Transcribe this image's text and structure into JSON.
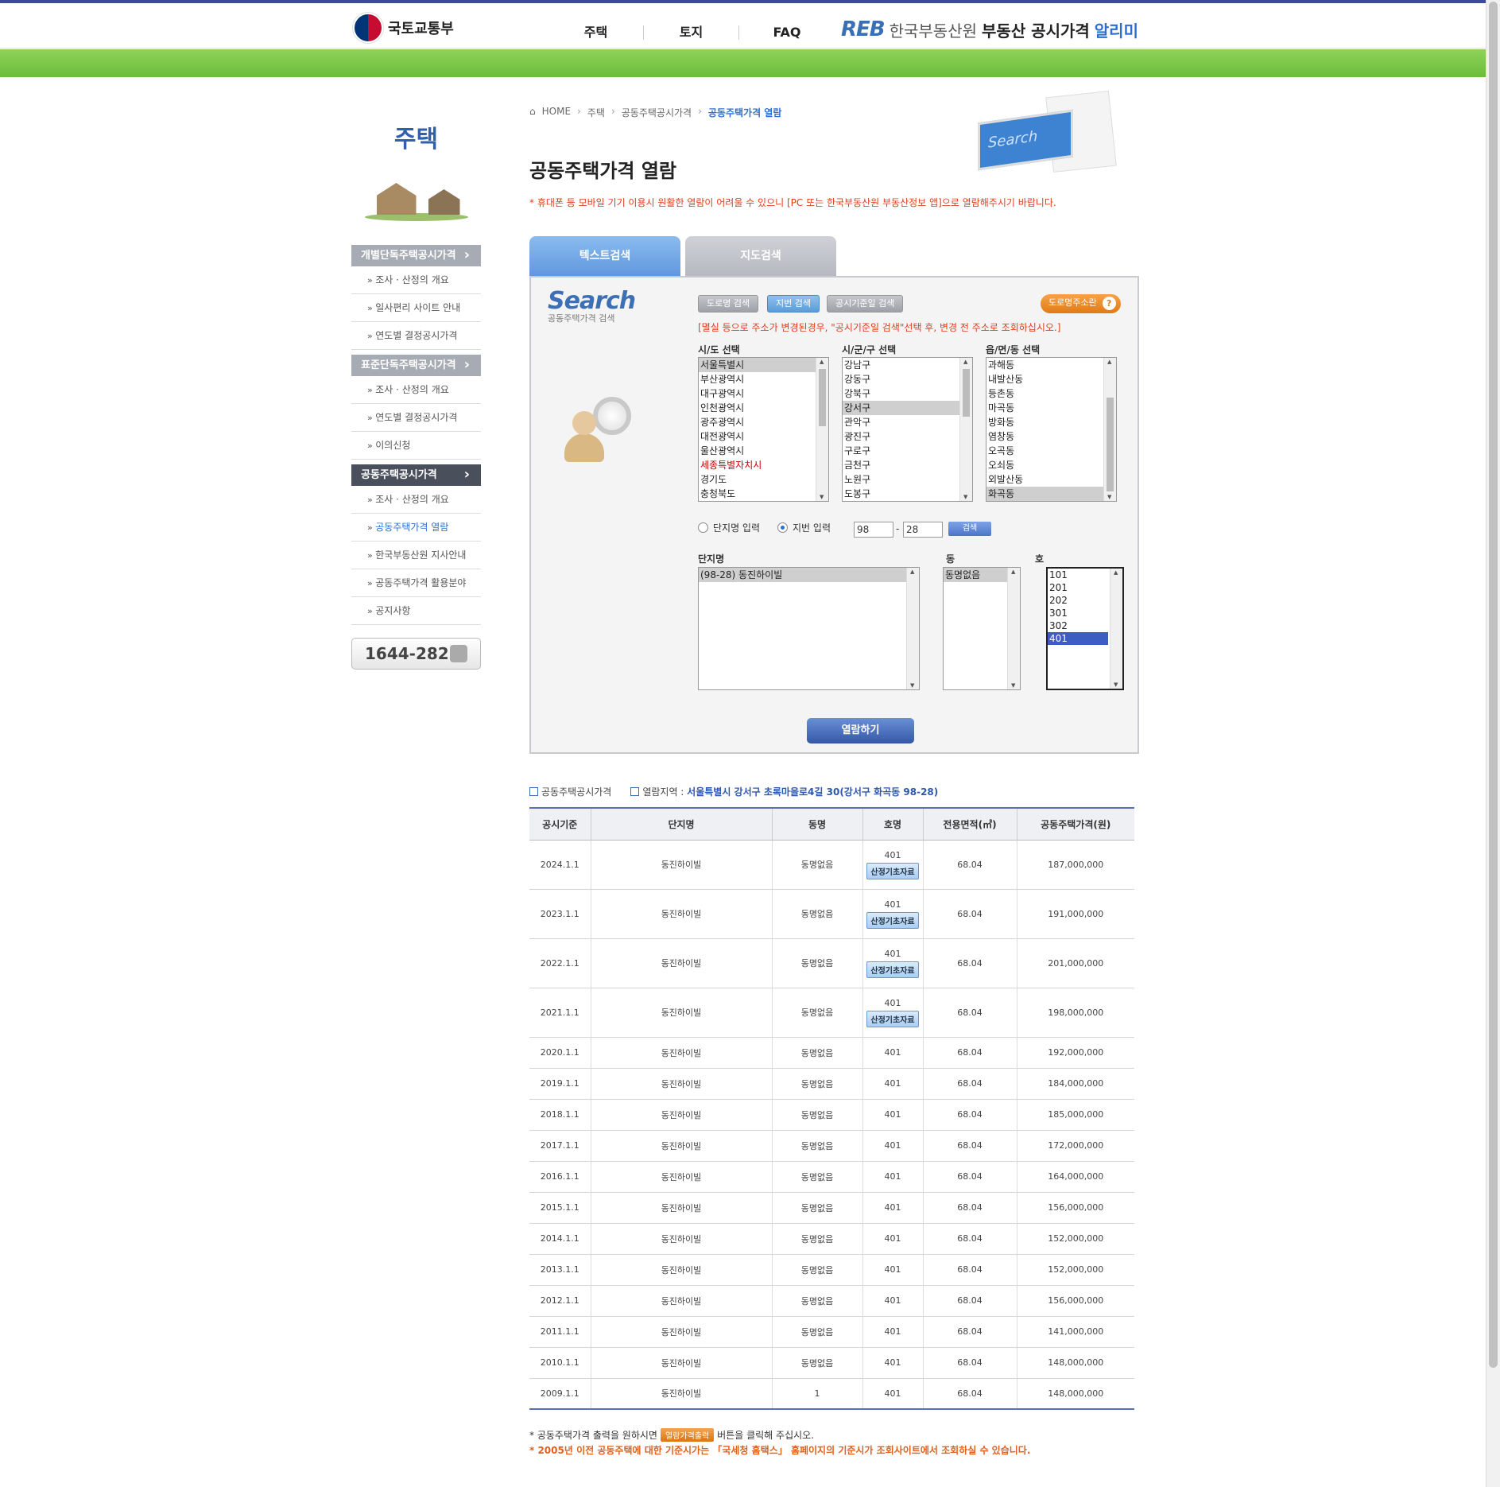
{
  "header": {
    "gov_logo": "국토교통부",
    "nav": [
      "주택",
      "토지",
      "FAQ"
    ],
    "brand_reb": "REB",
    "brand_org": "한국부동산원",
    "brand_service": "부동산 공시가격",
    "brand_service2": "알리미"
  },
  "sidebar": {
    "title": "주택",
    "groups": [
      {
        "label": "개별단독주택공시가격",
        "active": false,
        "items": [
          "조사 · 산정의 개요",
          "일사편리 사이트 안내",
          "연도별 결정공시가격"
        ]
      },
      {
        "label": "표준단독주택공시가격",
        "active": false,
        "items": [
          "조사 · 산정의 개요",
          "연도별 결정공시가격",
          "이의신청"
        ]
      },
      {
        "label": "공동주택공시가격",
        "active": true,
        "items": [
          "조사 · 산정의 개요",
          "공동주택가격 열람",
          "한국부동산원 지사안내",
          "공동주택가격 활용분야",
          "공지사항"
        ]
      }
    ],
    "phone": "1644-2828"
  },
  "breadcrumb": [
    "HOME",
    "주택",
    "공동주택공시가격",
    "공동주택가격 열람"
  ],
  "page": {
    "title": "공동주택가격 열람",
    "notice": "* 휴대폰 등 모바일 기기 이용시 원활한 열람이 어려울 수 있으니 [PC 또는 한국부동산원 부동산정보 앱]으로 열람해주시기 바랍니다.",
    "hero_text": "Search"
  },
  "tabs": [
    "텍스트검색",
    "지도검색"
  ],
  "search": {
    "logo": "Search",
    "logo_sub": "공동주택가격 검색",
    "buttons": [
      "도로명 검색",
      "지번 검색",
      "공시기준일 검색"
    ],
    "road_info": "도로명주소란",
    "warning": "[멸실 등으로 주소가 변경된경우, \"공시기준일 검색\"선택 후, 변경 전 주소로 조회하십시오.]",
    "sido_label": "시/도 선택",
    "sido": [
      "서울특별시",
      "부산광역시",
      "대구광역시",
      "인천광역시",
      "광주광역시",
      "대전광역시",
      "울산광역시",
      "세종특별자치시",
      "경기도",
      "충청북도"
    ],
    "sigungu_label": "시/군/구 선택",
    "sigungu": [
      "강남구",
      "강동구",
      "강북구",
      "강서구",
      "관악구",
      "광진구",
      "구로구",
      "금천구",
      "노원구",
      "도봉구"
    ],
    "dong_label": "읍/면/동 선택",
    "dong": [
      "과해동",
      "내발산동",
      "등촌동",
      "마곡동",
      "방화동",
      "염창동",
      "오곡동",
      "오쇠동",
      "외발산동",
      "화곡동"
    ],
    "radio_complex": "단지명 입력",
    "radio_lot": "지번 입력",
    "lot_main": "98",
    "lot_sub": "28",
    "dash": "-",
    "go": "검색",
    "complex_label": "단지명",
    "complex": [
      "(98-28) 동진하이빌"
    ],
    "building_label": "동",
    "building": [
      "동명없음"
    ],
    "unit_label": "호",
    "units": [
      "101",
      "201",
      "202",
      "301",
      "302",
      "401"
    ],
    "view_button": "열람하기"
  },
  "result": {
    "title": "공동주택공시가격",
    "area_label": "열람지역 : ",
    "area": "서울특별시 강서구 초록마을로4길 30(강서구 화곡동 98-28)",
    "columns": [
      "공시기준",
      "단지명",
      "동명",
      "호명",
      "전용면적(㎡)",
      "공동주택가격(원)"
    ],
    "calc_label": "산정기초자료",
    "rows": [
      {
        "date": "2024.1.1",
        "name": "동진하이빌",
        "dong": "동명없음",
        "ho": "401",
        "area": "68.04",
        "price": "187,000,000",
        "calc": true
      },
      {
        "date": "2023.1.1",
        "name": "동진하이빌",
        "dong": "동명없음",
        "ho": "401",
        "area": "68.04",
        "price": "191,000,000",
        "calc": true
      },
      {
        "date": "2022.1.1",
        "name": "동진하이빌",
        "dong": "동명없음",
        "ho": "401",
        "area": "68.04",
        "price": "201,000,000",
        "calc": true
      },
      {
        "date": "2021.1.1",
        "name": "동진하이빌",
        "dong": "동명없음",
        "ho": "401",
        "area": "68.04",
        "price": "198,000,000",
        "calc": true
      },
      {
        "date": "2020.1.1",
        "name": "동진하이빌",
        "dong": "동명없음",
        "ho": "401",
        "area": "68.04",
        "price": "192,000,000",
        "calc": false
      },
      {
        "date": "2019.1.1",
        "name": "동진하이빌",
        "dong": "동명없음",
        "ho": "401",
        "area": "68.04",
        "price": "184,000,000",
        "calc": false
      },
      {
        "date": "2018.1.1",
        "name": "동진하이빌",
        "dong": "동명없음",
        "ho": "401",
        "area": "68.04",
        "price": "185,000,000",
        "calc": false
      },
      {
        "date": "2017.1.1",
        "name": "동진하이빌",
        "dong": "동명없음",
        "ho": "401",
        "area": "68.04",
        "price": "172,000,000",
        "calc": false
      },
      {
        "date": "2016.1.1",
        "name": "동진하이빌",
        "dong": "동명없음",
        "ho": "401",
        "area": "68.04",
        "price": "164,000,000",
        "calc": false
      },
      {
        "date": "2015.1.1",
        "name": "동진하이빌",
        "dong": "동명없음",
        "ho": "401",
        "area": "68.04",
        "price": "156,000,000",
        "calc": false
      },
      {
        "date": "2014.1.1",
        "name": "동진하이빌",
        "dong": "동명없음",
        "ho": "401",
        "area": "68.04",
        "price": "152,000,000",
        "calc": false
      },
      {
        "date": "2013.1.1",
        "name": "동진하이빌",
        "dong": "동명없음",
        "ho": "401",
        "area": "68.04",
        "price": "152,000,000",
        "calc": false
      },
      {
        "date": "2012.1.1",
        "name": "동진하이빌",
        "dong": "동명없음",
        "ho": "401",
        "area": "68.04",
        "price": "156,000,000",
        "calc": false
      },
      {
        "date": "2011.1.1",
        "name": "동진하이빌",
        "dong": "동명없음",
        "ho": "401",
        "area": "68.04",
        "price": "141,000,000",
        "calc": false
      },
      {
        "date": "2010.1.1",
        "name": "동진하이빌",
        "dong": "동명없음",
        "ho": "401",
        "area": "68.04",
        "price": "148,000,000",
        "calc": false
      },
      {
        "date": "2009.1.1",
        "name": "동진하이빌",
        "dong": "1",
        "ho": "401",
        "area": "68.04",
        "price": "148,000,000",
        "calc": false
      }
    ]
  },
  "footer": {
    "line1_a": "* 공동주택가격 출력을 원하시면",
    "print_button": "열람가격출력",
    "line1_b": "버튼을 클릭해 주십시오.",
    "line2": "* 2005년 이전 공동주택에 대한 기준시가는 「국세청 홈택스」 홈페이지의 기준시가 조회사이트에서 조회하실 수 있습니다."
  }
}
